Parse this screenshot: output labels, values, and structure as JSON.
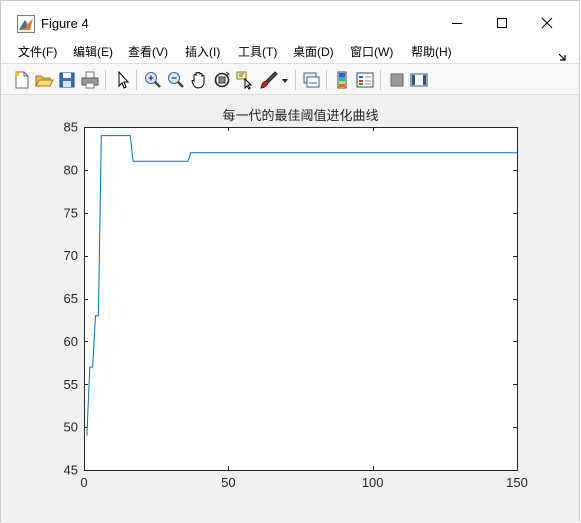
{
  "window": {
    "title": "Figure 4"
  },
  "menu": {
    "items": [
      "文件(F)",
      "编辑(E)",
      "查看(V)",
      "插入(I)",
      "工具(T)",
      "桌面(D)",
      "窗口(W)",
      "帮助(H)"
    ]
  },
  "toolbar": {
    "icons": [
      "new-figure-icon",
      "open-file-icon",
      "save-icon",
      "print-icon",
      "edit-plot-arrow-icon",
      "zoom-in-icon",
      "zoom-out-icon",
      "pan-hand-icon",
      "rotate-3d-icon",
      "data-cursor-icon",
      "brush-icon",
      "brush-dropdown-icon",
      "link-plot-icon",
      "insert-colorbar-icon",
      "insert-legend-icon",
      "hide-plot-tools-icon",
      "show-plot-tools-icon"
    ]
  },
  "chart_data": {
    "type": "line",
    "title": "每一代的最佳阈值进化曲线",
    "xlabel": "",
    "ylabel": "",
    "xlim": [
      0,
      150
    ],
    "ylim": [
      45,
      85
    ],
    "xticks": [
      0,
      50,
      100,
      150
    ],
    "yticks": [
      45,
      50,
      55,
      60,
      65,
      70,
      75,
      80,
      85
    ],
    "grid": false,
    "color": "#0072BD",
    "series": [
      {
        "x": [
          1,
          2,
          3,
          4,
          5,
          6,
          7,
          15,
          16,
          17,
          18,
          35,
          36,
          37,
          150
        ],
        "values": [
          49,
          57,
          57,
          63,
          63,
          84,
          84,
          84,
          84,
          81,
          81,
          81,
          81,
          82,
          82
        ]
      }
    ]
  }
}
